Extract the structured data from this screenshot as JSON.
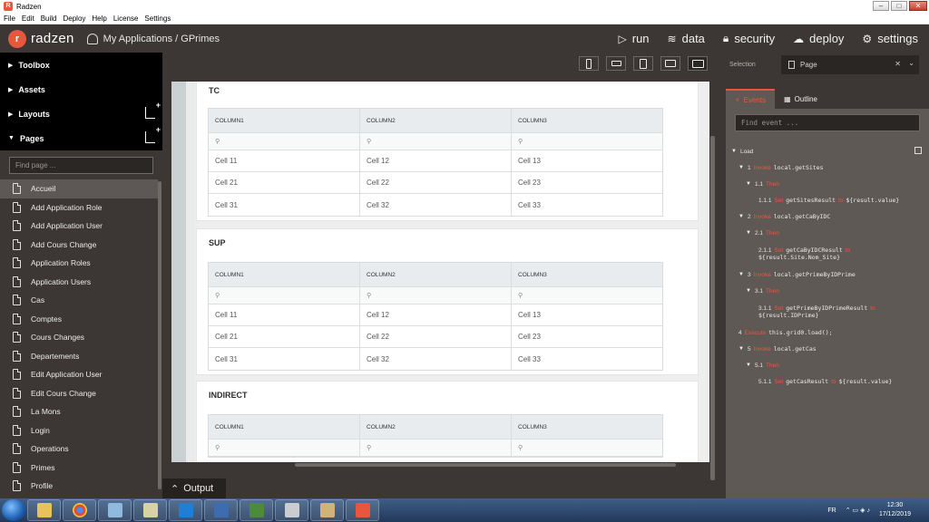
{
  "window": {
    "title": "Radzen"
  },
  "menu": [
    "File",
    "Edit",
    "Build",
    "Deploy",
    "Help",
    "License",
    "Settings"
  ],
  "header": {
    "logo_text": "radzen",
    "breadcrumb": "My Applications / GPrimes",
    "nav": {
      "run": "run",
      "data": "data",
      "security": "security",
      "deploy": "deploy",
      "settings": "settings"
    }
  },
  "sidebar": {
    "toolbox": "Toolbox",
    "assets": "Assets",
    "layouts": "Layouts",
    "pages": "Pages",
    "find_placeholder": "Find page ...",
    "page_list": [
      "Accueil",
      "Add Application Role",
      "Add Application User",
      "Add Cours Change",
      "Application Roles",
      "Application Users",
      "Cas",
      "Comptes",
      "Cours Changes",
      "Departements",
      "Edit Application User",
      "Edit Cours Change",
      "La Mons",
      "Login",
      "Operations",
      "Primes",
      "Profile"
    ],
    "active_page": "Accueil"
  },
  "designer": {
    "cards": [
      {
        "title": "TC",
        "columns": [
          "COLUMN1",
          "COLUMN2",
          "COLUMN3"
        ],
        "rows": [
          [
            "Cell 11",
            "Cell 12",
            "Cell 13"
          ],
          [
            "Cell 21",
            "Cell 22",
            "Cell 23"
          ],
          [
            "Cell 31",
            "Cell 32",
            "Cell 33"
          ]
        ]
      },
      {
        "title": "SUP",
        "columns": [
          "COLUMN1",
          "COLUMN2",
          "COLUMN3"
        ],
        "rows": [
          [
            "Cell 11",
            "Cell 12",
            "Cell 13"
          ],
          [
            "Cell 21",
            "Cell 22",
            "Cell 23"
          ],
          [
            "Cell 31",
            "Cell 32",
            "Cell 33"
          ]
        ]
      },
      {
        "title": "INDIRECT",
        "columns": [
          "COLUMN1",
          "COLUMN2",
          "COLUMN3"
        ],
        "rows": []
      }
    ]
  },
  "right_panel": {
    "selection_label": "Selection",
    "selection_value": "Page",
    "tabs": {
      "events": "Events",
      "outline": "Outline"
    },
    "find_event_placeholder": "Find event ...",
    "event_root": "Load",
    "events": [
      {
        "num": "1",
        "kw": "Invoke",
        "text": "local.getSites"
      },
      {
        "num": "1.1",
        "kw": "Then",
        "text": ""
      },
      {
        "num": "1.1.1",
        "kw": "Set",
        "text": "getSitesResult",
        "to": "to",
        "value": "${result.value}"
      },
      {
        "num": "2",
        "kw": "Invoke",
        "text": "local.getCaByIDC"
      },
      {
        "num": "2.1",
        "kw": "Then",
        "text": ""
      },
      {
        "num": "2.1.1",
        "kw": "Set",
        "text": "getCaByIDCResult",
        "to": "to",
        "value": "${result.Site.Nom_Site}"
      },
      {
        "num": "3",
        "kw": "Invoke",
        "text": "local.getPrimeByIDPrime"
      },
      {
        "num": "3.1",
        "kw": "Then",
        "text": ""
      },
      {
        "num": "3.1.1",
        "kw": "Set",
        "text": "getPrimeByIDPrimeResult",
        "to": "to",
        "value": "${result.IDPrime}"
      },
      {
        "num": "4",
        "kw": "Execute",
        "text": "this.grid0.load();"
      },
      {
        "num": "5",
        "kw": "Invoke",
        "text": "local.getCas"
      },
      {
        "num": "5.1",
        "kw": "Then",
        "text": ""
      },
      {
        "num": "5.1.1",
        "kw": "Set",
        "text": "getCasResult",
        "to": "to",
        "value": "${result.value}"
      }
    ]
  },
  "output": {
    "label": "Output"
  },
  "taskbar": {
    "lang": "FR",
    "time": "12:30",
    "date": "17/12/2019"
  }
}
